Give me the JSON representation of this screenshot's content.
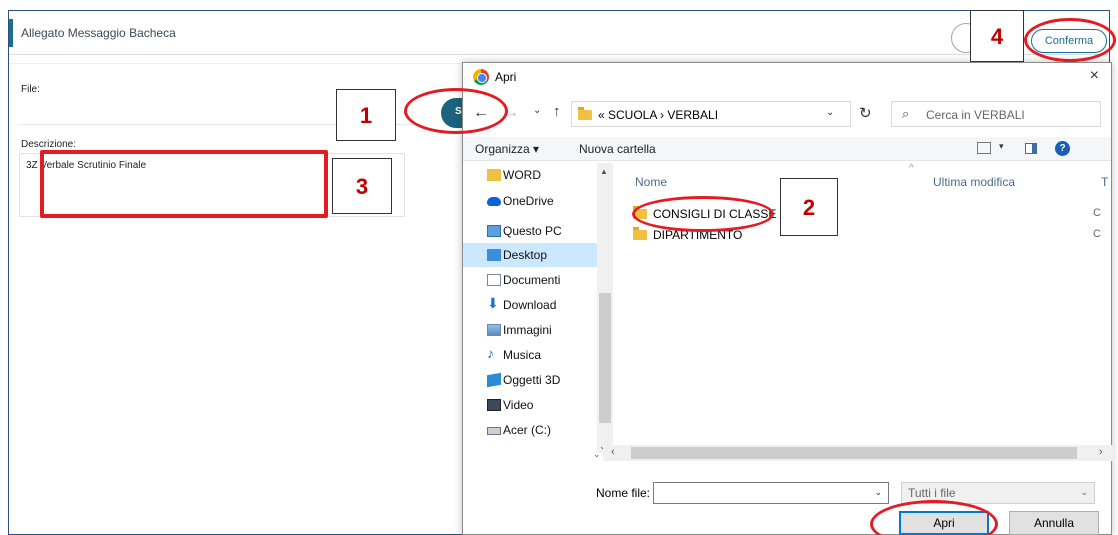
{
  "app": {
    "title": "Allegato Messaggio Bacheca",
    "confirm_label": "Conferma",
    "file_label": "File:",
    "select_button_label": "S",
    "description_label": "Descrizione:",
    "description_value": "3Z Verbale Scrutinio Finale"
  },
  "annotations": [
    "1",
    "2",
    "3",
    "4"
  ],
  "dialog": {
    "title": "Apri",
    "close_symbol": "×",
    "nav": {
      "back": "←",
      "forward": "→",
      "recent": "⌄",
      "up": "↑",
      "refresh": "↻"
    },
    "address_path": "« SCUOLA › VERBALI",
    "address_chevron": "⌄",
    "search_placeholder": "Cerca in VERBALI",
    "toolbar": {
      "organize": "Organizza ▾",
      "new_folder": "Nuova cartella",
      "help": "?"
    },
    "nav_pane": [
      {
        "label": "WORD",
        "icon": "folder-icon"
      },
      {
        "label": "OneDrive",
        "icon": "onedrive-icon"
      },
      {
        "label": "Questo PC",
        "icon": "pc-icon"
      },
      {
        "label": "Desktop",
        "icon": "desktop-icon",
        "selected": true
      },
      {
        "label": "Documenti",
        "icon": "documents-icon"
      },
      {
        "label": "Download",
        "icon": "download-icon"
      },
      {
        "label": "Immagini",
        "icon": "images-icon"
      },
      {
        "label": "Musica",
        "icon": "music-icon"
      },
      {
        "label": "Oggetti 3D",
        "icon": "objects-3d-icon"
      },
      {
        "label": "Video",
        "icon": "video-icon"
      },
      {
        "label": "Acer (C:)",
        "icon": "drive-icon"
      }
    ],
    "columns": {
      "name": "Nome",
      "modified": "Ultima modifica",
      "type": "T"
    },
    "files": [
      {
        "name": "CONSIGLI DI CLASSE",
        "type_abbrev": "C"
      },
      {
        "name": "DIPARTIMENTO",
        "type_abbrev": "C"
      }
    ],
    "filename_label": "Nome file:",
    "filename_value": "",
    "filetype_value": "Tutti i file",
    "open_label": "Apri",
    "cancel_label": "Annulla"
  },
  "colors": {
    "annotation_red": "#e31b23",
    "accent_teal": "#1a6e8e",
    "selected_bg": "#cce8ff"
  }
}
